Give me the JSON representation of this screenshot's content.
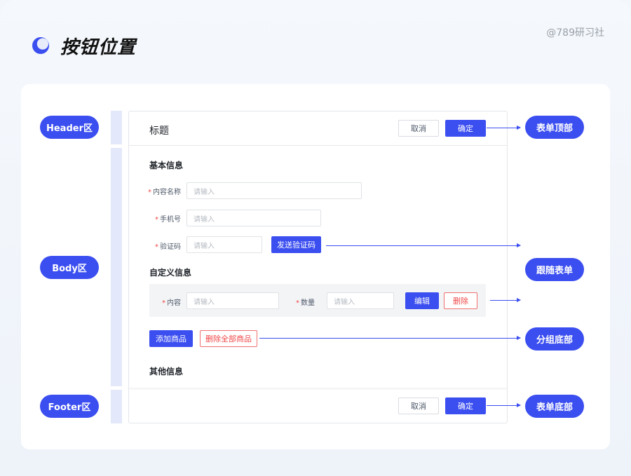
{
  "header": {
    "title": "按钮位置",
    "watermark": "@789研习社"
  },
  "regions": {
    "header": "Header区",
    "body": "Body区",
    "footer": "Footer区"
  },
  "positions": {
    "top": "表单顶部",
    "follow": "跟随表单",
    "group_bottom": "分组底部",
    "bottom": "表单底部"
  },
  "form": {
    "title": "标题",
    "cancel": "取消",
    "confirm": "确定",
    "sections": {
      "basic": "基本信息",
      "custom": "自定义信息",
      "other": "其他信息"
    },
    "fields": {
      "content_name": "内容名称",
      "phone": "手机号",
      "code": "验证码",
      "content": "内容",
      "quantity": "数量",
      "required_mark": "*"
    },
    "placeholder": "请输入",
    "send_code": "发送验证码",
    "edit": "编辑",
    "delete": "删除",
    "add_product": "添加商品",
    "delete_all": "删除全部商品"
  },
  "colors": {
    "accent": "#3b4ef0",
    "danger": "#f04848",
    "region_bar": "#e4e8fb"
  }
}
